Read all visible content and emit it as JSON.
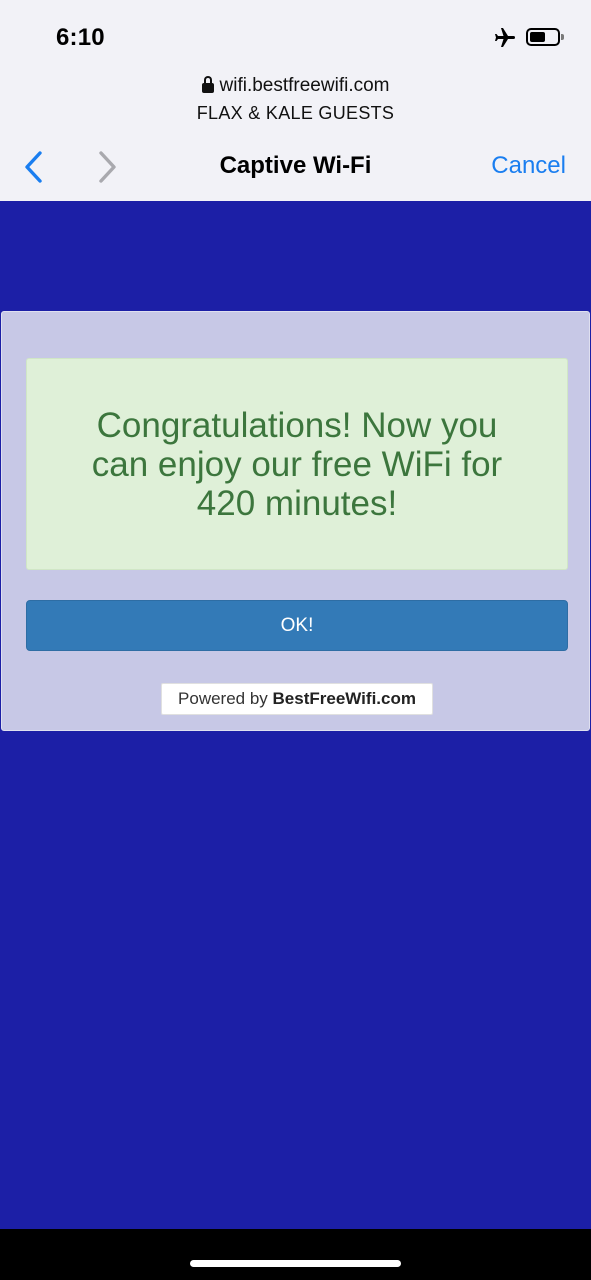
{
  "status_bar": {
    "time": "6:10",
    "icons": [
      "airplane-mode-icon",
      "battery-icon"
    ]
  },
  "url_bar": {
    "url": "wifi.bestfreewifi.com",
    "site_name": "FLAX & KALE GUESTS",
    "lock_icon": "lock-icon"
  },
  "nav_bar": {
    "title": "Captive Wi-Fi",
    "cancel_label": "Cancel",
    "back_icon": "chevron-left-icon",
    "forward_icon": "chevron-right-icon",
    "accent_color": "#1a7ef0"
  },
  "portal": {
    "background_color": "#1c1fa6",
    "message": "Congratulations! Now you can enjoy our free WiFi for 420 minutes!",
    "ok_label": "OK!",
    "powered_by_prefix": "Powered by",
    "powered_by_brand": "BestFreeWifi.com"
  }
}
